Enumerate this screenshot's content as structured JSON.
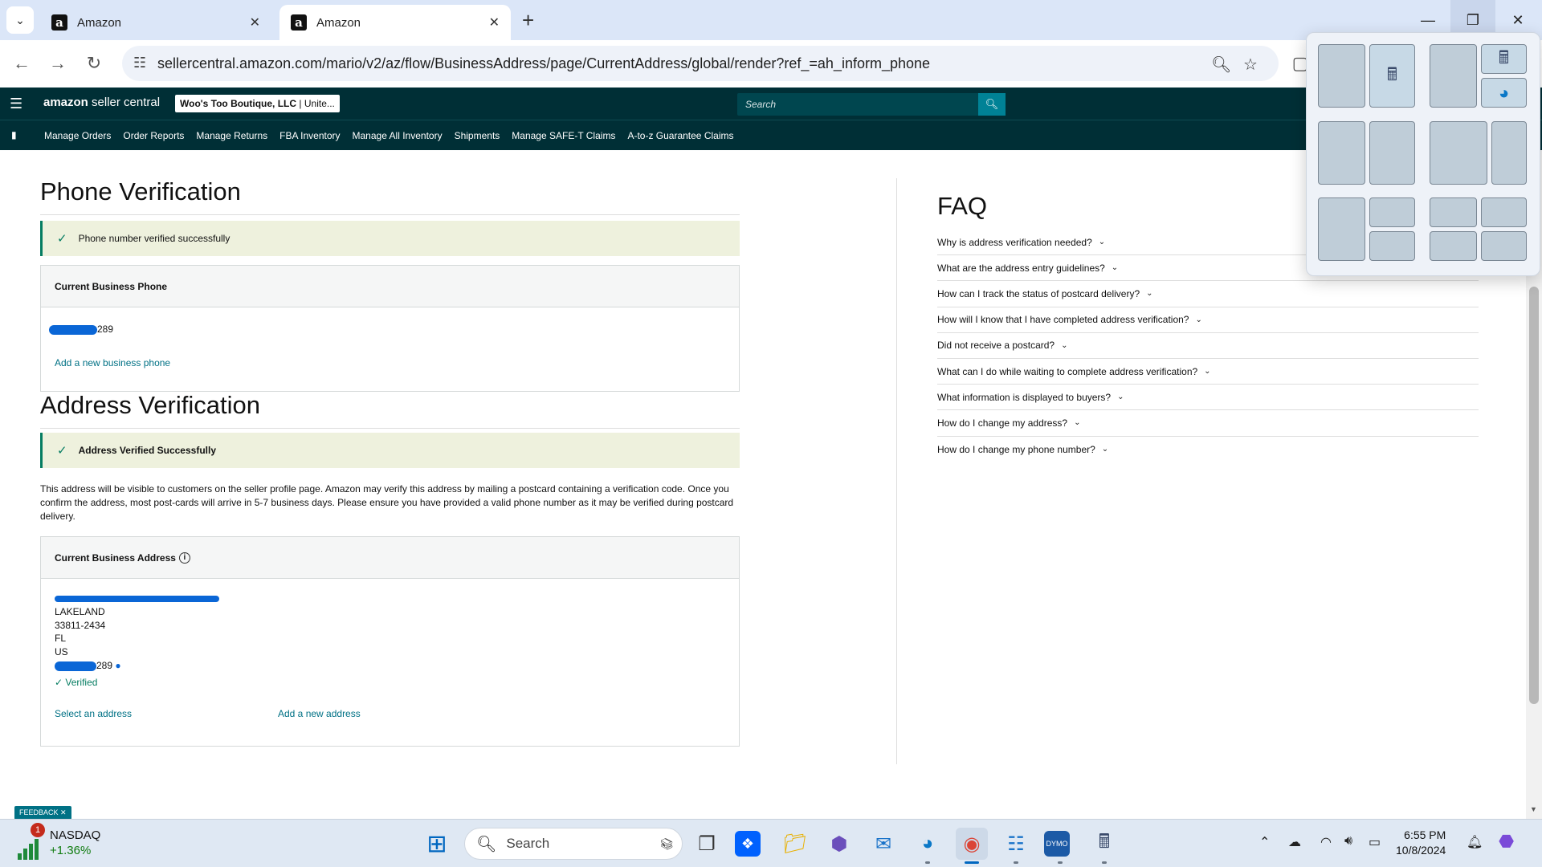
{
  "browser": {
    "tabs": [
      {
        "title": "Amazon",
        "active": false
      },
      {
        "title": "Amazon",
        "active": true
      }
    ],
    "url": "sellercentral.amazon.com/mario/v2/az/flow/BusinessAddress/page/CurrentAddress/global/render?ref_=ah_inform_phone",
    "icons": [
      "tab-search-icon",
      "back-icon",
      "forward-icon",
      "reload-icon",
      "site-info-icon",
      "zoom-icon",
      "star-icon",
      "extensions-icon",
      "minimize-icon",
      "restore-icon",
      "close-icon"
    ]
  },
  "header": {
    "logo_brand": "amazon",
    "logo_suffix": "seller central",
    "account_name": "Woo's Too Boutique, LLC",
    "account_market": "| Unite...",
    "search_placeholder": "Search"
  },
  "nav": {
    "items": [
      "Manage Orders",
      "Order Reports",
      "Manage Returns",
      "FBA Inventory",
      "Manage All Inventory",
      "Shipments",
      "Manage SAFE-T Claims",
      "A-to-z Guarantee Claims"
    ]
  },
  "phone_section": {
    "title": "Phone Verification",
    "alert": "Phone number verified successfully",
    "box_title": "Current Business Phone",
    "phone_suffix": "289",
    "add_link": "Add a new business phone"
  },
  "address_section": {
    "title": "Address Verification",
    "alert": "Address Verified Successfully",
    "description": "This address will be visible to customers on the seller profile page. Amazon may verify this address by mailing a postcard containing a verification code. Once you confirm the address, most post-cards will arrive in 5-7 business days. Please ensure you have provided a valid phone number as it may be verified during postcard delivery.",
    "box_title": "Current Business Address",
    "lines": [
      "LAKELAND",
      "33811-2434",
      "FL",
      "US"
    ],
    "phone_suffix": "289",
    "verified_label": "Verified",
    "select_link": "Select an address",
    "add_link": "Add a new address"
  },
  "faq": {
    "title": "FAQ",
    "items": [
      "Why is address verification needed?",
      "What are the address entry guidelines?",
      "How can I track the status of postcard delivery?",
      "How will I know that I have completed address verification?",
      "Did not receive a postcard?",
      "What can I do while waiting to complete address verification?",
      "What information is displayed to buyers?",
      "How do I change my address?",
      "How do I change my phone number?"
    ]
  },
  "feedback_label": "FEEDBACK",
  "taskbar": {
    "stock_name": "NASDAQ",
    "stock_change": "+1.36%",
    "notification_count": "1",
    "search_label": "Search",
    "time": "6:55 PM",
    "date": "10/8/2024"
  }
}
